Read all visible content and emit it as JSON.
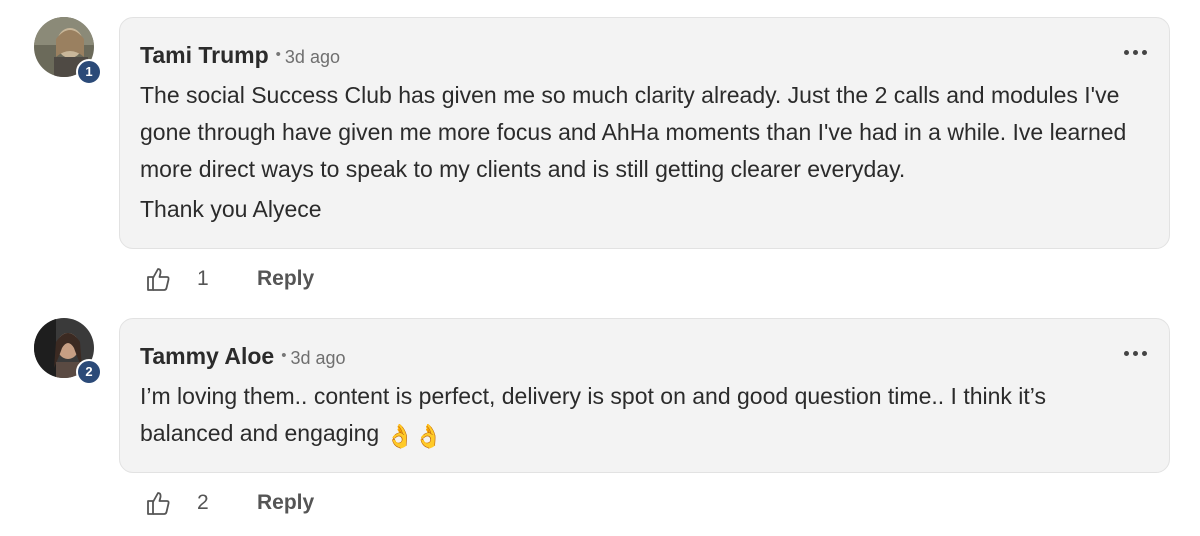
{
  "comments": [
    {
      "author": "Tami Trump",
      "level": "1",
      "separator": "•",
      "time": "3d ago",
      "paragraphs": [
        "The social Success Club has given me so much clarity already. Just the 2 calls and modules I've gone through have given me more focus and AhHa moments than I've had in a while. Ive learned more direct ways to speak to my clients and is still getting clearer everyday.",
        "Thank you Alyece"
      ],
      "likes": "1",
      "reply_label": "Reply"
    },
    {
      "author": "Tammy Aloe",
      "level": "2",
      "separator": "•",
      "time": "3d ago",
      "text": "I’m loving them.. content is perfect, delivery is spot on and good question time.. I think it’s balanced and engaging",
      "emoji": "👌👌",
      "likes": "2",
      "reply_label": "Reply"
    }
  ],
  "icons": {
    "like": "thumbs-up-icon",
    "more": "more-options-icon"
  },
  "colors": {
    "level_badge": "#2b4a78",
    "bubble_bg": "#f3f3f3"
  }
}
